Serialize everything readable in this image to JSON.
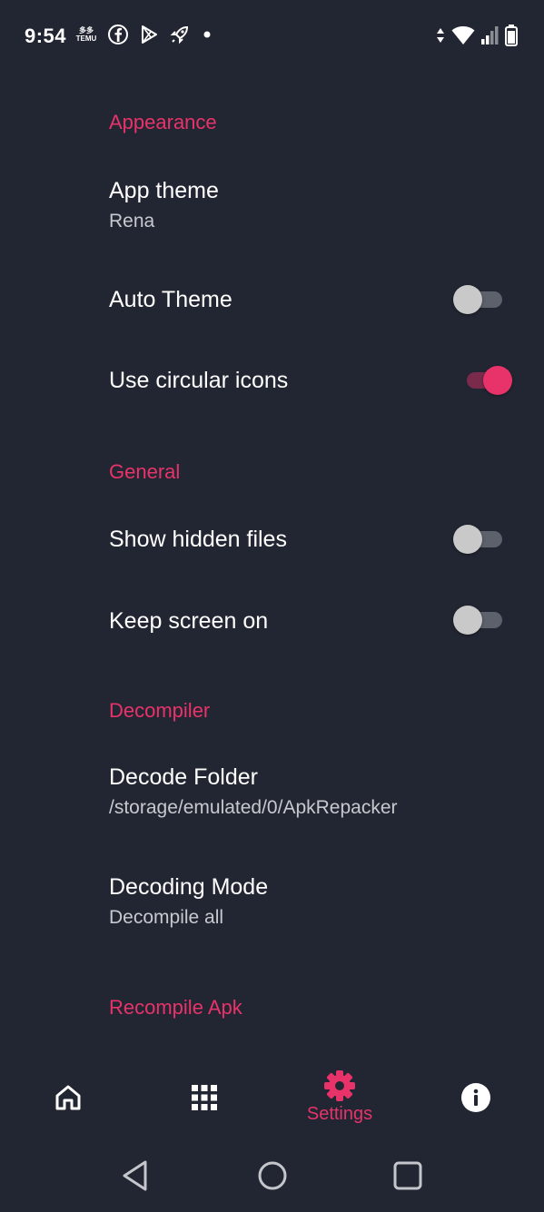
{
  "status_bar": {
    "time": "9:54",
    "temu_label_top": "多多",
    "temu_label": "TEMU",
    "icons": [
      "temu-icon",
      "facebook-icon",
      "play-store-icon",
      "rocket-icon",
      "dot-icon"
    ],
    "right_icons": [
      "data-arrows-icon",
      "wifi-icon",
      "signal-icon",
      "battery-icon"
    ]
  },
  "sections": {
    "appearance": {
      "header": "Appearance",
      "app_theme_title": "App theme",
      "app_theme_value": "Rena",
      "auto_theme_title": "Auto Theme",
      "auto_theme_on": false,
      "circular_icons_title": "Use circular icons",
      "circular_icons_on": true
    },
    "general": {
      "header": "General",
      "hidden_files_title": "Show hidden files",
      "hidden_files_on": false,
      "keep_screen_title": "Keep screen on",
      "keep_screen_on": false
    },
    "decompiler": {
      "header": "Decompiler",
      "decode_folder_title": "Decode Folder",
      "decode_folder_value": "/storage/emulated/0/ApkRepacker",
      "decoding_mode_title": "Decoding Mode",
      "decoding_mode_value": "Decompile all"
    },
    "recompile": {
      "header": "Recompile Apk"
    }
  },
  "bottom_nav": {
    "items": [
      {
        "icon": "home-icon",
        "label": "",
        "active": false
      },
      {
        "icon": "apps-grid-icon",
        "label": "",
        "active": false
      },
      {
        "icon": "gear-icon",
        "label": "Settings",
        "active": true
      },
      {
        "icon": "info-icon",
        "label": "",
        "active": false
      }
    ]
  },
  "system_nav": {
    "icons": [
      "back-icon",
      "home-circle-icon",
      "recents-icon"
    ]
  },
  "colors": {
    "background": "#222632",
    "accent": "#e8336a",
    "text_primary": "#ffffff",
    "text_secondary": "#c7c9cf"
  }
}
